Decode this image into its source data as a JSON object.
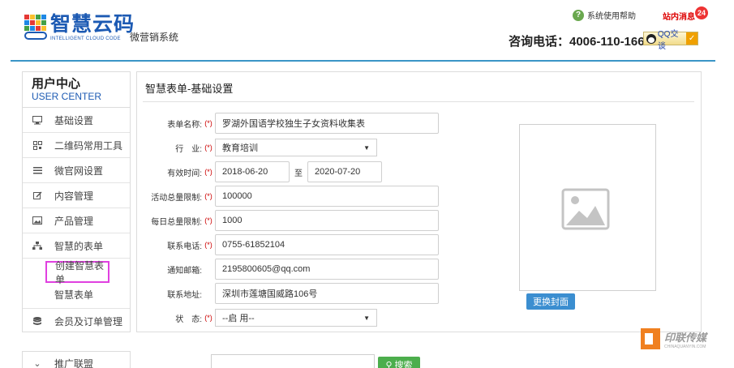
{
  "header": {
    "logo_cn": "智慧云码",
    "logo_en": "INTELLIGENT CLOUD CODE",
    "subtitle": "微营销系统",
    "help_text": "系统使用帮助",
    "messages_text": "站内消息",
    "messages_count": "24",
    "phone": "咨询电话：4006-110-166",
    "qq_label": "QQ交谈"
  },
  "sidebar": {
    "title_cn": "用户中心",
    "title_en": "USER CENTER",
    "items": [
      {
        "label": "基础设置",
        "icon": "monitor-icon"
      },
      {
        "label": "二维码常用工具",
        "icon": "qrcode-icon"
      },
      {
        "label": "微官网设置",
        "icon": "list-icon"
      },
      {
        "label": "内容管理",
        "icon": "edit-icon"
      },
      {
        "label": "产品管理",
        "icon": "image-icon"
      },
      {
        "label": "智慧的表单",
        "icon": "sitemap-icon"
      }
    ],
    "sub_items": [
      "创建智慧表单",
      "智慧表单"
    ],
    "items_after": [
      {
        "label": "会员及订单管理",
        "icon": "database-icon"
      }
    ],
    "bottom_item": "推广联盟"
  },
  "form": {
    "title": "智慧表单-基础设置",
    "required_mark": "(*)",
    "fields": {
      "name": {
        "label": "表单名称:",
        "value": "罗湖外国语学校独生子女资料收集表"
      },
      "industry": {
        "label": "行　业:",
        "value": "教育培训"
      },
      "period": {
        "label": "有效时间:",
        "start": "2018-06-20",
        "sep": "至",
        "end": "2020-07-20"
      },
      "total_limit": {
        "label": "活动总量限制:",
        "value": "100000"
      },
      "daily_limit": {
        "label": "每日总量限制:",
        "value": "1000"
      },
      "phone": {
        "label": "联系电话:",
        "value": "0755-61852104"
      },
      "email": {
        "label": "通知邮箱:",
        "value": "2195800605@qq.com"
      },
      "address": {
        "label": "联系地址:",
        "value": "深圳市莲塘国威路106号"
      },
      "status": {
        "label": "状　态:",
        "value": "--启 用--"
      }
    },
    "cover_button": "更换封面"
  },
  "bottom": {
    "search_button": "搜索"
  },
  "watermark": {
    "cn": "印联传媒",
    "en": "CHINAQUANYIN.COM"
  }
}
